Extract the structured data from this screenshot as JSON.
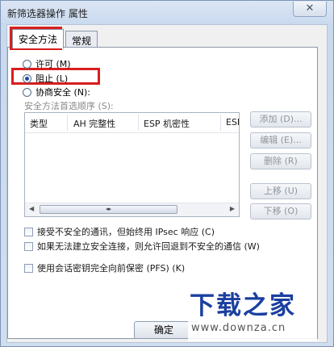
{
  "window": {
    "title": "新筛选器操作 属性",
    "close_glyph": "✕"
  },
  "tabs": [
    {
      "label": "安全方法",
      "active": true
    },
    {
      "label": "常规",
      "active": false
    }
  ],
  "radio_options": [
    {
      "label": "许可 (M)",
      "checked": false
    },
    {
      "label": "阻止 (L)",
      "checked": true
    },
    {
      "label": "协商安全 (N):",
      "checked": false
    }
  ],
  "methods": {
    "label": "安全方法首选顺序 (S):",
    "columns": [
      "类型",
      "AH 完整性",
      "ESP 机密性",
      "ESI"
    ],
    "rows": []
  },
  "side_buttons": [
    "添加 (D)...",
    "编辑 (E)...",
    "删除 (R)",
    "上移 (U)",
    "下移 (O)"
  ],
  "checkboxes": [
    {
      "label": "接受不安全的通讯，但始终用 IPsec 响应 (C)",
      "checked": false
    },
    {
      "label": "如果无法建立安全连接，则允许回退到不安全的通信 (W)",
      "checked": false
    },
    {
      "label": "使用会话密钥完全向前保密 (PFS) (K)",
      "checked": false
    }
  ],
  "footer": {
    "ok_label": "确定"
  },
  "watermark": {
    "logo": "下载之家",
    "url": "www.downza.cn"
  },
  "colors": {
    "highlight": "#d81e1e",
    "watermark_blue": "#1b3fa0"
  }
}
